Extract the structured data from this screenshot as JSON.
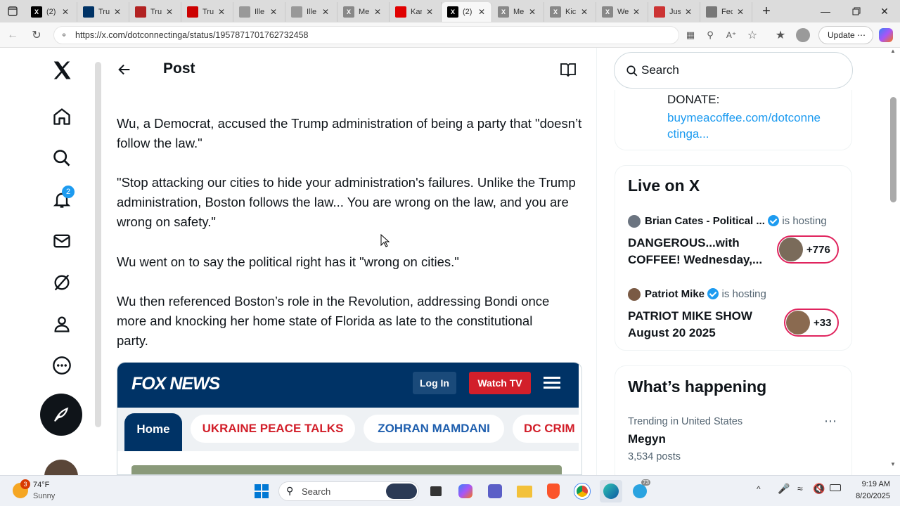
{
  "browser": {
    "tabs": [
      {
        "icon": "x-icon",
        "label": "(2)",
        "color": "#000000"
      },
      {
        "icon": "fox-news-icon",
        "label": "Tru",
        "color": "#003366"
      },
      {
        "icon": "news-icon",
        "label": "Tru",
        "color": "#b22222"
      },
      {
        "icon": "cnn-icon",
        "label": "Tru",
        "color": "#cc0000"
      },
      {
        "icon": "gp-icon",
        "label": "Ille",
        "color": "#999999"
      },
      {
        "icon": "gp-icon",
        "label": "Ille",
        "color": "#999999"
      },
      {
        "icon": "x-gray-icon",
        "label": "Me",
        "color": "#888888"
      },
      {
        "icon": "n-icon",
        "label": "Kar",
        "color": "#e00000"
      },
      {
        "icon": "x-icon",
        "label": "(2)",
        "color": "#000000"
      },
      {
        "icon": "x-gray-icon",
        "label": "Me",
        "color": "#888888"
      },
      {
        "icon": "x-gray-icon",
        "label": "Kic",
        "color": "#888888"
      },
      {
        "icon": "x-gray-icon",
        "label": "We",
        "color": "#888888"
      },
      {
        "icon": "ap-icon",
        "label": "Jus",
        "color": "#cc3333"
      },
      {
        "icon": "pn-icon",
        "label": "Fec",
        "color": "#777777"
      }
    ],
    "active_tab": 8,
    "url": "https://x.com/dotconnectinga/status/1957871701762732458",
    "update_label": "Update"
  },
  "sidebar": {
    "notification_count": "2"
  },
  "post": {
    "header_title": "Post",
    "paragraphs": [
      "Wu, a Democrat, accused the Trump administration of being a party that \"doesn’t follow the law.\"",
      "\"Stop attacking our cities to hide your administration's failures. Unlike the Trump administration, Boston follows the law... You are wrong on the law, and you are wrong on safety.\"",
      "Wu went on to say the political right has it \"wrong on cities.\"",
      "Wu then referenced Boston’s role in the Revolution, addressing Bondi once more and knocking her home state of Florida as late to the constitutional party."
    ],
    "embed": {
      "logo": "FOX NEWS",
      "login": "Log In",
      "watch": "Watch TV",
      "nav_home": "Home",
      "nav_items": [
        "UKRAINE PEACE TALKS",
        "ZOHRAN MAMDANI",
        "DC CRIM"
      ]
    }
  },
  "right": {
    "search_placeholder": "Search",
    "bio": {
      "donate_label": "DONATE:",
      "link_line1": "buymeacoffee.com/dotconne",
      "link_line2": "ctinga..."
    },
    "live": {
      "heading": "Live on X",
      "items": [
        {
          "host": "Brian Cates - Political ...",
          "status": "is hosting",
          "title_line1": "DANGEROUS...with",
          "title_line2": "COFFEE! Wednesday,...",
          "count": "+776"
        },
        {
          "host": "Patriot Mike",
          "status": "is hosting",
          "title_line1": "PATRIOT MIKE SHOW",
          "title_line2": "August 20 2025",
          "count": "+33"
        }
      ]
    },
    "happening": {
      "heading": "What’s happening",
      "trend_context": "Trending in United States",
      "trend_name": "Megyn",
      "trend_posts": "3,534 posts"
    }
  },
  "taskbar": {
    "weather_temp": "74°F",
    "weather_desc": "Sunny",
    "weather_badge": "3",
    "search_label": "Search",
    "time": "9:19 AM",
    "date": "8/20/2025",
    "telegram_badge": "73"
  }
}
